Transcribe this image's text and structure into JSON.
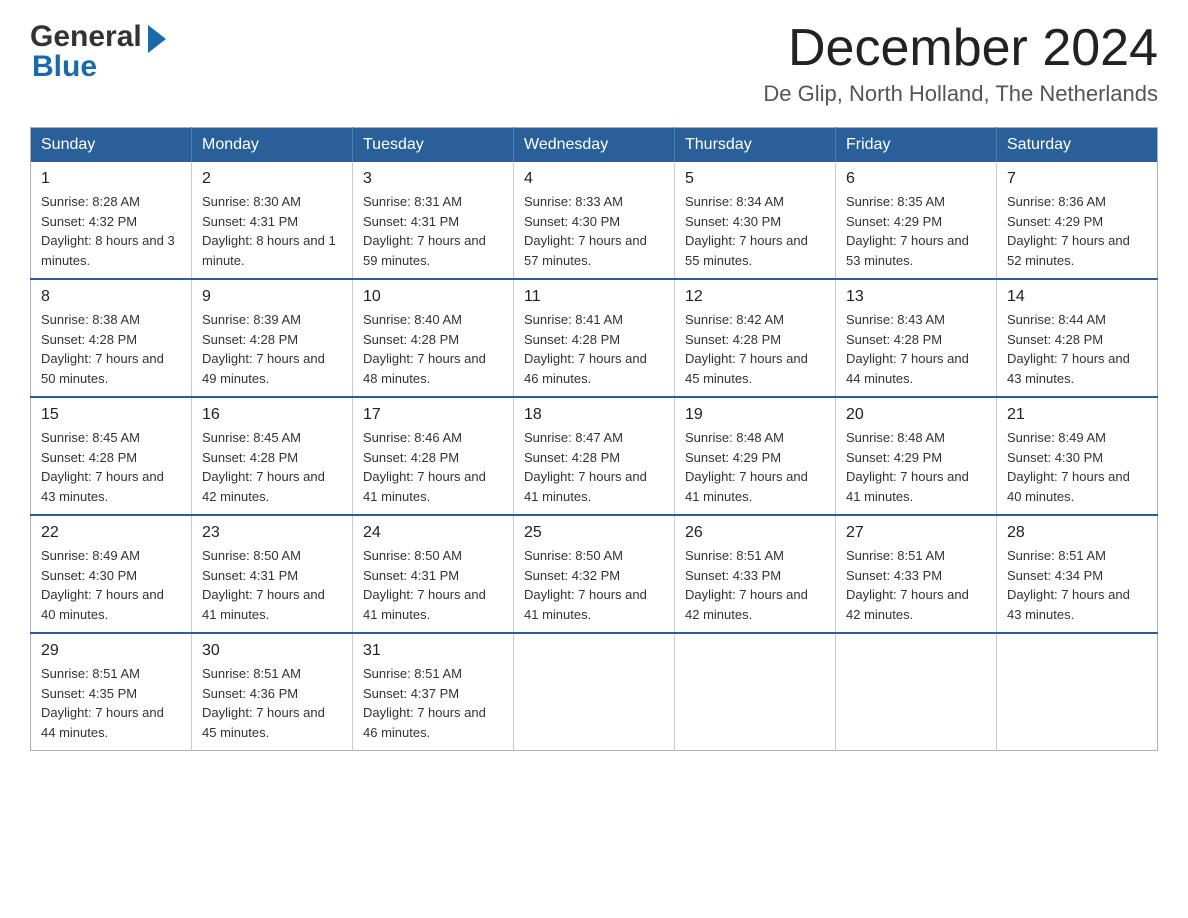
{
  "header": {
    "title": "December 2024",
    "location": "De Glip, North Holland, The Netherlands",
    "logo_general": "General",
    "logo_blue": "Blue"
  },
  "calendar": {
    "days_of_week": [
      "Sunday",
      "Monday",
      "Tuesday",
      "Wednesday",
      "Thursday",
      "Friday",
      "Saturday"
    ],
    "weeks": [
      [
        {
          "day": "1",
          "sunrise": "8:28 AM",
          "sunset": "4:32 PM",
          "daylight": "8 hours and 3 minutes."
        },
        {
          "day": "2",
          "sunrise": "8:30 AM",
          "sunset": "4:31 PM",
          "daylight": "8 hours and 1 minute."
        },
        {
          "day": "3",
          "sunrise": "8:31 AM",
          "sunset": "4:31 PM",
          "daylight": "7 hours and 59 minutes."
        },
        {
          "day": "4",
          "sunrise": "8:33 AM",
          "sunset": "4:30 PM",
          "daylight": "7 hours and 57 minutes."
        },
        {
          "day": "5",
          "sunrise": "8:34 AM",
          "sunset": "4:30 PM",
          "daylight": "7 hours and 55 minutes."
        },
        {
          "day": "6",
          "sunrise": "8:35 AM",
          "sunset": "4:29 PM",
          "daylight": "7 hours and 53 minutes."
        },
        {
          "day": "7",
          "sunrise": "8:36 AM",
          "sunset": "4:29 PM",
          "daylight": "7 hours and 52 minutes."
        }
      ],
      [
        {
          "day": "8",
          "sunrise": "8:38 AM",
          "sunset": "4:28 PM",
          "daylight": "7 hours and 50 minutes."
        },
        {
          "day": "9",
          "sunrise": "8:39 AM",
          "sunset": "4:28 PM",
          "daylight": "7 hours and 49 minutes."
        },
        {
          "day": "10",
          "sunrise": "8:40 AM",
          "sunset": "4:28 PM",
          "daylight": "7 hours and 48 minutes."
        },
        {
          "day": "11",
          "sunrise": "8:41 AM",
          "sunset": "4:28 PM",
          "daylight": "7 hours and 46 minutes."
        },
        {
          "day": "12",
          "sunrise": "8:42 AM",
          "sunset": "4:28 PM",
          "daylight": "7 hours and 45 minutes."
        },
        {
          "day": "13",
          "sunrise": "8:43 AM",
          "sunset": "4:28 PM",
          "daylight": "7 hours and 44 minutes."
        },
        {
          "day": "14",
          "sunrise": "8:44 AM",
          "sunset": "4:28 PM",
          "daylight": "7 hours and 43 minutes."
        }
      ],
      [
        {
          "day": "15",
          "sunrise": "8:45 AM",
          "sunset": "4:28 PM",
          "daylight": "7 hours and 43 minutes."
        },
        {
          "day": "16",
          "sunrise": "8:45 AM",
          "sunset": "4:28 PM",
          "daylight": "7 hours and 42 minutes."
        },
        {
          "day": "17",
          "sunrise": "8:46 AM",
          "sunset": "4:28 PM",
          "daylight": "7 hours and 41 minutes."
        },
        {
          "day": "18",
          "sunrise": "8:47 AM",
          "sunset": "4:28 PM",
          "daylight": "7 hours and 41 minutes."
        },
        {
          "day": "19",
          "sunrise": "8:48 AM",
          "sunset": "4:29 PM",
          "daylight": "7 hours and 41 minutes."
        },
        {
          "day": "20",
          "sunrise": "8:48 AM",
          "sunset": "4:29 PM",
          "daylight": "7 hours and 41 minutes."
        },
        {
          "day": "21",
          "sunrise": "8:49 AM",
          "sunset": "4:30 PM",
          "daylight": "7 hours and 40 minutes."
        }
      ],
      [
        {
          "day": "22",
          "sunrise": "8:49 AM",
          "sunset": "4:30 PM",
          "daylight": "7 hours and 40 minutes."
        },
        {
          "day": "23",
          "sunrise": "8:50 AM",
          "sunset": "4:31 PM",
          "daylight": "7 hours and 41 minutes."
        },
        {
          "day": "24",
          "sunrise": "8:50 AM",
          "sunset": "4:31 PM",
          "daylight": "7 hours and 41 minutes."
        },
        {
          "day": "25",
          "sunrise": "8:50 AM",
          "sunset": "4:32 PM",
          "daylight": "7 hours and 41 minutes."
        },
        {
          "day": "26",
          "sunrise": "8:51 AM",
          "sunset": "4:33 PM",
          "daylight": "7 hours and 42 minutes."
        },
        {
          "day": "27",
          "sunrise": "8:51 AM",
          "sunset": "4:33 PM",
          "daylight": "7 hours and 42 minutes."
        },
        {
          "day": "28",
          "sunrise": "8:51 AM",
          "sunset": "4:34 PM",
          "daylight": "7 hours and 43 minutes."
        }
      ],
      [
        {
          "day": "29",
          "sunrise": "8:51 AM",
          "sunset": "4:35 PM",
          "daylight": "7 hours and 44 minutes."
        },
        {
          "day": "30",
          "sunrise": "8:51 AM",
          "sunset": "4:36 PM",
          "daylight": "7 hours and 45 minutes."
        },
        {
          "day": "31",
          "sunrise": "8:51 AM",
          "sunset": "4:37 PM",
          "daylight": "7 hours and 46 minutes."
        },
        null,
        null,
        null,
        null
      ]
    ]
  }
}
